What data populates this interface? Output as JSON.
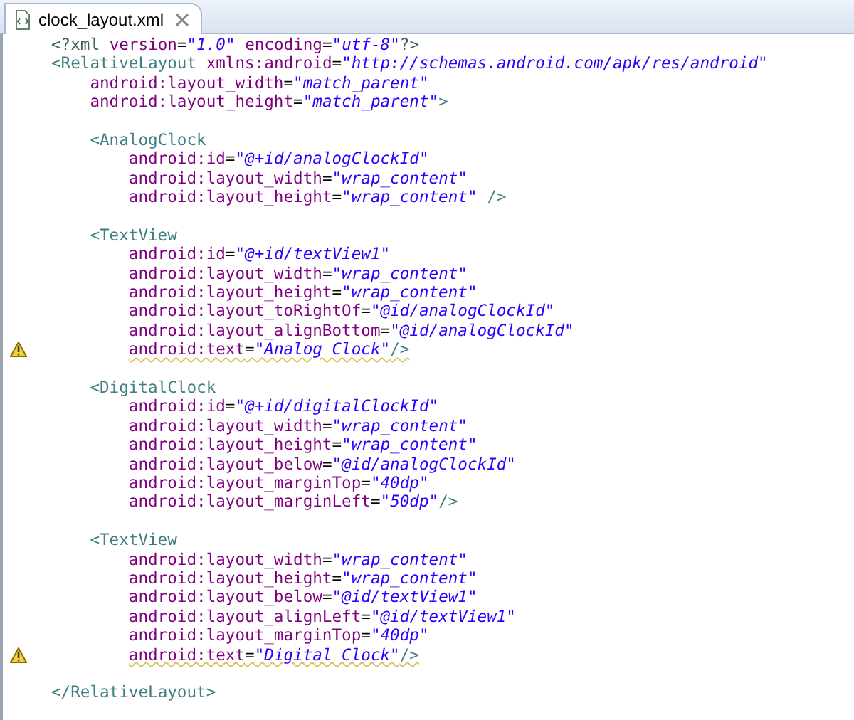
{
  "tab": {
    "title": "clock_layout.xml",
    "selected": true
  },
  "lines": [
    {
      "kind": "code",
      "warning": false,
      "parts": [
        {
          "kind": "decl",
          "text": "<?xml"
        },
        {
          "kind": "attr",
          "text": " version"
        },
        {
          "kind": "punct",
          "text": "="
        },
        {
          "kind": "value",
          "text": "\"1.0\""
        },
        {
          "kind": "attr",
          "text": " encoding"
        },
        {
          "kind": "punct",
          "text": "="
        },
        {
          "kind": "value",
          "text": "\"utf-8\""
        },
        {
          "kind": "decl",
          "text": "?>"
        }
      ]
    },
    {
      "kind": "code",
      "warning": false,
      "parts": [
        {
          "kind": "tag",
          "text": "<RelativeLayout"
        },
        {
          "kind": "attr",
          "text": " xmlns:android"
        },
        {
          "kind": "punct",
          "text": "="
        },
        {
          "kind": "value",
          "text": "\"http://schemas.android.com/apk/res/android\""
        }
      ],
      "children": [
        {
          "kind": "code",
          "warning": false,
          "parts": [
            {
              "kind": "attr",
              "text": "android:layout_width"
            },
            {
              "kind": "punct",
              "text": "="
            },
            {
              "kind": "value",
              "text": "\"match_parent\""
            }
          ]
        },
        {
          "kind": "code",
          "warning": false,
          "parts": [
            {
              "kind": "attr",
              "text": "android:layout_height"
            },
            {
              "kind": "punct",
              "text": "="
            },
            {
              "kind": "value",
              "text": "\"match_parent\""
            },
            {
              "kind": "tag",
              "text": ">"
            }
          ]
        },
        {
          "kind": "blank"
        },
        {
          "kind": "code",
          "warning": false,
          "parts": [
            {
              "kind": "tag",
              "text": "<AnalogClock"
            }
          ],
          "children": [
            {
              "kind": "code",
              "warning": false,
              "parts": [
                {
                  "kind": "attr",
                  "text": "android:id"
                },
                {
                  "kind": "punct",
                  "text": "="
                },
                {
                  "kind": "value",
                  "text": "\"@+id/analogClockId\""
                }
              ]
            },
            {
              "kind": "code",
              "warning": false,
              "parts": [
                {
                  "kind": "attr",
                  "text": "android:layout_width"
                },
                {
                  "kind": "punct",
                  "text": "="
                },
                {
                  "kind": "value",
                  "text": "\"wrap_content\""
                }
              ]
            },
            {
              "kind": "code",
              "warning": false,
              "parts": [
                {
                  "kind": "attr",
                  "text": "android:layout_height"
                },
                {
                  "kind": "punct",
                  "text": "="
                },
                {
                  "kind": "value",
                  "text": "\"wrap_content\""
                },
                {
                  "kind": "tag",
                  "text": " />"
                }
              ]
            }
          ]
        },
        {
          "kind": "blank"
        },
        {
          "kind": "code",
          "warning": false,
          "parts": [
            {
              "kind": "tag",
              "text": "<TextView"
            }
          ],
          "children": [
            {
              "kind": "code",
              "warning": false,
              "parts": [
                {
                  "kind": "attr",
                  "text": "android:id"
                },
                {
                  "kind": "punct",
                  "text": "="
                },
                {
                  "kind": "value",
                  "text": "\"@+id/textView1\""
                }
              ]
            },
            {
              "kind": "code",
              "warning": false,
              "parts": [
                {
                  "kind": "attr",
                  "text": "android:layout_width"
                },
                {
                  "kind": "punct",
                  "text": "="
                },
                {
                  "kind": "value",
                  "text": "\"wrap_content\""
                }
              ]
            },
            {
              "kind": "code",
              "warning": false,
              "parts": [
                {
                  "kind": "attr",
                  "text": "android:layout_height"
                },
                {
                  "kind": "punct",
                  "text": "="
                },
                {
                  "kind": "value",
                  "text": "\"wrap_content\""
                }
              ]
            },
            {
              "kind": "code",
              "warning": false,
              "parts": [
                {
                  "kind": "attr",
                  "text": "android:layout_toRightOf"
                },
                {
                  "kind": "punct",
                  "text": "="
                },
                {
                  "kind": "value",
                  "text": "\"@id/analogClockId\""
                }
              ]
            },
            {
              "kind": "code",
              "warning": false,
              "parts": [
                {
                  "kind": "attr",
                  "text": "android:layout_alignBottom"
                },
                {
                  "kind": "punct",
                  "text": "="
                },
                {
                  "kind": "value",
                  "text": "\"@id/analogClockId\""
                }
              ]
            },
            {
              "kind": "code",
              "warning": true,
              "parts": [
                {
                  "kind": "attr",
                  "text": "android:text"
                },
                {
                  "kind": "punct",
                  "text": "="
                },
                {
                  "kind": "value",
                  "text": "\"Analog Clock\""
                },
                {
                  "kind": "tag",
                  "text": "/>"
                }
              ]
            }
          ]
        },
        {
          "kind": "blank"
        },
        {
          "kind": "code",
          "warning": false,
          "parts": [
            {
              "kind": "tag",
              "text": "<DigitalClock"
            }
          ],
          "children": [
            {
              "kind": "code",
              "warning": false,
              "parts": [
                {
                  "kind": "attr",
                  "text": "android:id"
                },
                {
                  "kind": "punct",
                  "text": "="
                },
                {
                  "kind": "value",
                  "text": "\"@+id/digitalClockId\""
                }
              ]
            },
            {
              "kind": "code",
              "warning": false,
              "parts": [
                {
                  "kind": "attr",
                  "text": "android:layout_width"
                },
                {
                  "kind": "punct",
                  "text": "="
                },
                {
                  "kind": "value",
                  "text": "\"wrap_content\""
                }
              ]
            },
            {
              "kind": "code",
              "warning": false,
              "parts": [
                {
                  "kind": "attr",
                  "text": "android:layout_height"
                },
                {
                  "kind": "punct",
                  "text": "="
                },
                {
                  "kind": "value",
                  "text": "\"wrap_content\""
                }
              ]
            },
            {
              "kind": "code",
              "warning": false,
              "parts": [
                {
                  "kind": "attr",
                  "text": "android:layout_below"
                },
                {
                  "kind": "punct",
                  "text": "="
                },
                {
                  "kind": "value",
                  "text": "\"@id/analogClockId\""
                }
              ]
            },
            {
              "kind": "code",
              "warning": false,
              "parts": [
                {
                  "kind": "attr",
                  "text": "android:layout_marginTop"
                },
                {
                  "kind": "punct",
                  "text": "="
                },
                {
                  "kind": "value",
                  "text": "\"40dp\""
                }
              ]
            },
            {
              "kind": "code",
              "warning": false,
              "parts": [
                {
                  "kind": "attr",
                  "text": "android:layout_marginLeft"
                },
                {
                  "kind": "punct",
                  "text": "="
                },
                {
                  "kind": "value",
                  "text": "\"50dp\""
                },
                {
                  "kind": "tag",
                  "text": "/>"
                }
              ]
            }
          ]
        },
        {
          "kind": "blank"
        },
        {
          "kind": "code",
          "warning": false,
          "parts": [
            {
              "kind": "tag",
              "text": "<TextView"
            }
          ],
          "children": [
            {
              "kind": "code",
              "warning": false,
              "parts": [
                {
                  "kind": "attr",
                  "text": "android:layout_width"
                },
                {
                  "kind": "punct",
                  "text": "="
                },
                {
                  "kind": "value",
                  "text": "\"wrap_content\""
                }
              ]
            },
            {
              "kind": "code",
              "warning": false,
              "parts": [
                {
                  "kind": "attr",
                  "text": "android:layout_height"
                },
                {
                  "kind": "punct",
                  "text": "="
                },
                {
                  "kind": "value",
                  "text": "\"wrap_content\""
                }
              ]
            },
            {
              "kind": "code",
              "warning": false,
              "parts": [
                {
                  "kind": "attr",
                  "text": "android:layout_below"
                },
                {
                  "kind": "punct",
                  "text": "="
                },
                {
                  "kind": "value",
                  "text": "\"@id/textView1\""
                }
              ]
            },
            {
              "kind": "code",
              "warning": false,
              "parts": [
                {
                  "kind": "attr",
                  "text": "android:layout_alignLeft"
                },
                {
                  "kind": "punct",
                  "text": "="
                },
                {
                  "kind": "value",
                  "text": "\"@id/textView1\""
                }
              ]
            },
            {
              "kind": "code",
              "warning": false,
              "parts": [
                {
                  "kind": "attr",
                  "text": "android:layout_marginTop"
                },
                {
                  "kind": "punct",
                  "text": "="
                },
                {
                  "kind": "value",
                  "text": "\"40dp\""
                }
              ]
            },
            {
              "kind": "code",
              "warning": true,
              "parts": [
                {
                  "kind": "attr",
                  "text": "android:text"
                },
                {
                  "kind": "punct",
                  "text": "="
                },
                {
                  "kind": "value",
                  "text": "\"Digital Clock\""
                },
                {
                  "kind": "tag",
                  "text": "/>"
                }
              ]
            }
          ]
        },
        {
          "kind": "blank"
        }
      ]
    },
    {
      "kind": "code",
      "warning": false,
      "parts": [
        {
          "kind": "tag",
          "text": "</RelativeLayout>"
        }
      ]
    }
  ]
}
